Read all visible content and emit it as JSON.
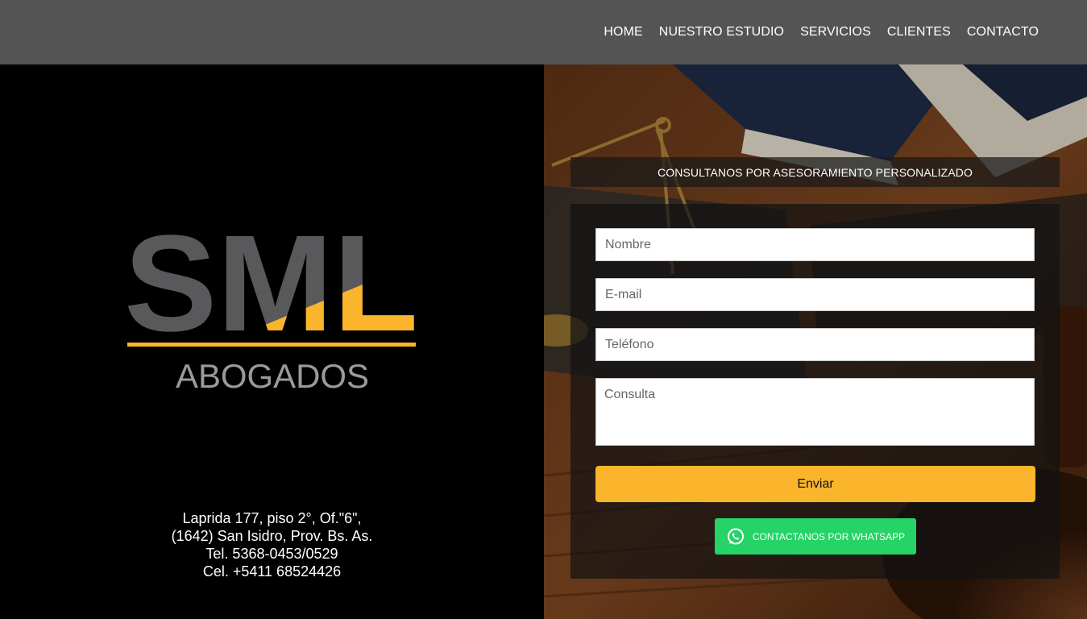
{
  "nav": {
    "items": [
      {
        "label": "HOME"
      },
      {
        "label": "NUESTRO ESTUDIO"
      },
      {
        "label": "SERVICIOS"
      },
      {
        "label": "CLIENTES"
      },
      {
        "label": "CONTACTO"
      }
    ]
  },
  "logo": {
    "wordmark": "SML",
    "tagline": "ABOGADOS",
    "colors": {
      "grey": "#59595b",
      "yellow": "#fbb52c"
    }
  },
  "address": {
    "line1": "Laprida 177, piso 2°, Of.\"6\",",
    "line2": "(1642) San Isidro, Prov. Bs. As.",
    "line3": "Tel. 5368-0453/0529",
    "line4": "Cel. +5411 68524426"
  },
  "form": {
    "title": "CONSULTANOS POR ASESORAMIENTO PERSONALIZADO",
    "name_placeholder": "Nombre",
    "email_placeholder": "E-mail",
    "phone_placeholder": "Teléfono",
    "message_placeholder": "Consulta",
    "submit_label": "Enviar",
    "whatsapp_label": "CONTACTANOS POR WHATSAPP"
  },
  "colors": {
    "topbar": "#545454",
    "accent": "#fbb52c",
    "whatsapp": "#25d366"
  },
  "icons": {
    "whatsapp": "whatsapp-icon"
  }
}
